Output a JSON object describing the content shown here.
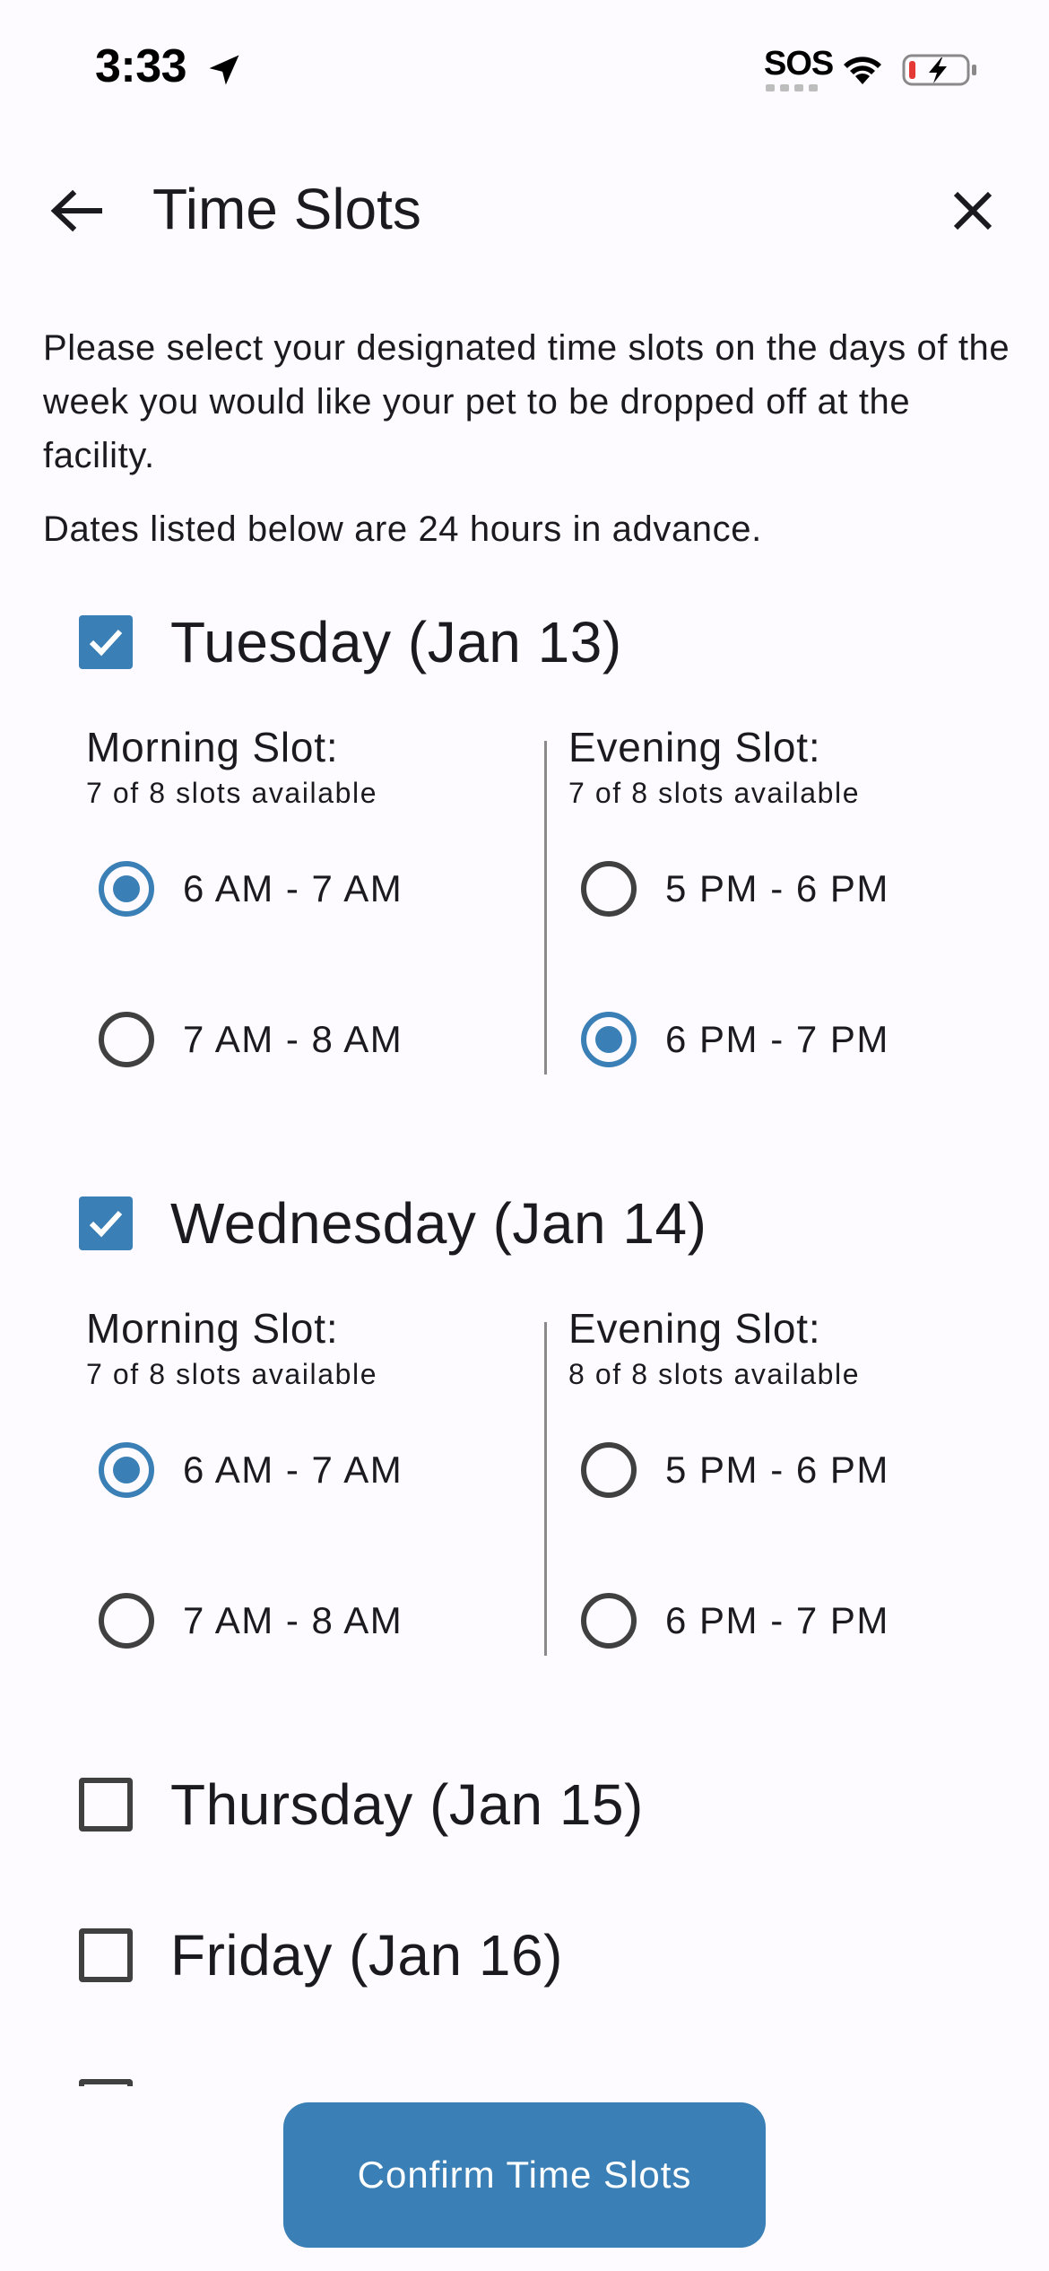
{
  "status_bar": {
    "time": "3:33",
    "sos": "SOS"
  },
  "app_bar": {
    "title": "Time Slots"
  },
  "intro_text": "Please select your designated time slots on the days of the week you would like your pet to be dropped off at the facility.",
  "note_text": "Dates listed below are 24 hours in advance.",
  "colors": {
    "accent": "#3a7fb5",
    "text": "#1b1b1f",
    "background": "#fdfbff"
  },
  "days": [
    {
      "label": "Tuesday (Jan 13)",
      "checked": true,
      "morning": {
        "title": "Morning Slot:",
        "availability": "7 of 8 slots available",
        "options": [
          {
            "label": "6 AM - 7 AM",
            "selected": true
          },
          {
            "label": "7 AM - 8 AM",
            "selected": false
          }
        ]
      },
      "evening": {
        "title": "Evening Slot:",
        "availability": "7 of 8 slots available",
        "options": [
          {
            "label": "5 PM - 6 PM",
            "selected": false
          },
          {
            "label": "6 PM - 7 PM",
            "selected": true
          }
        ]
      }
    },
    {
      "label": "Wednesday (Jan 14)",
      "checked": true,
      "morning": {
        "title": "Morning Slot:",
        "availability": "7 of 8 slots available",
        "options": [
          {
            "label": "6 AM - 7 AM",
            "selected": true
          },
          {
            "label": "7 AM - 8 AM",
            "selected": false
          }
        ]
      },
      "evening": {
        "title": "Evening Slot:",
        "availability": "8 of 8 slots available",
        "options": [
          {
            "label": "5 PM - 6 PM",
            "selected": false
          },
          {
            "label": "6 PM - 7 PM",
            "selected": false
          }
        ]
      }
    },
    {
      "label": "Thursday (Jan 15)",
      "checked": false
    },
    {
      "label": "Friday (Jan 16)",
      "checked": false
    }
  ],
  "confirm_button": {
    "label": "Confirm Time Slots"
  }
}
